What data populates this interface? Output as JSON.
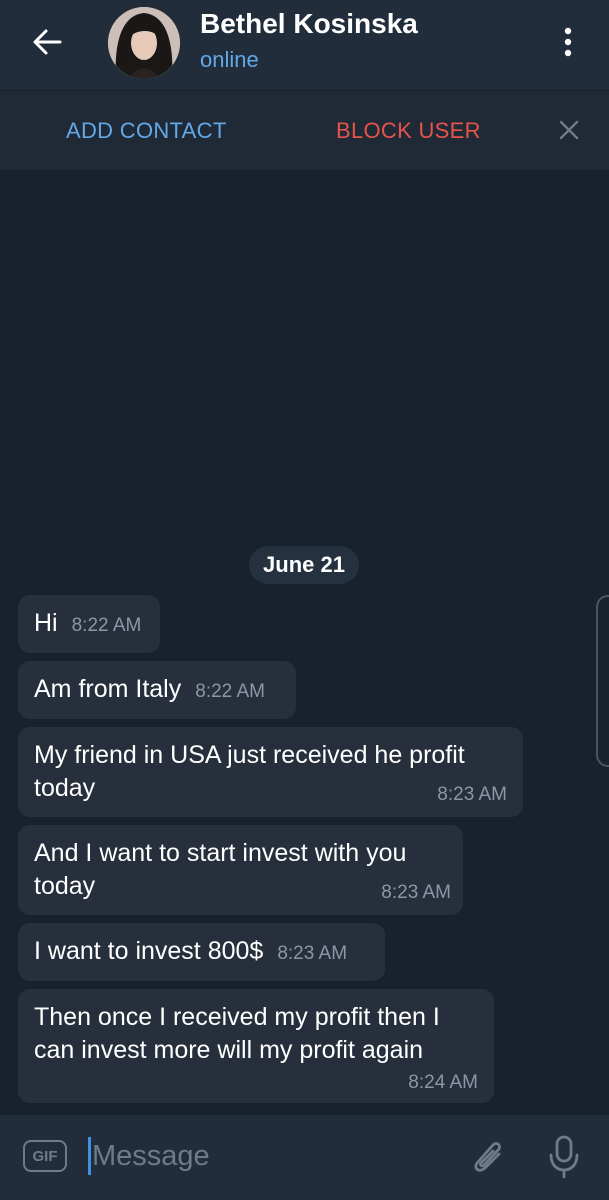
{
  "header": {
    "name": "Bethel Kosinska",
    "status": "online",
    "icons": {
      "back": "arrow-left-icon",
      "menu": "more-vertical-icon"
    }
  },
  "action_bar": {
    "add_contact": "ADD CONTACT",
    "block_user": "BLOCK USER",
    "close_icon": "close-icon"
  },
  "chat": {
    "date": "June 21",
    "messages": [
      {
        "text": "Hi",
        "time": "8:22 AM"
      },
      {
        "text": "Am from Italy",
        "time": "8:22 AM"
      },
      {
        "text": "My friend in USA just received he profit today",
        "time": "8:23 AM"
      },
      {
        "text": "And I want to start invest with you today",
        "time": "8:23 AM"
      },
      {
        "text": "I want to invest 800$",
        "time": "8:23 AM"
      },
      {
        "text": "Then once I received my profit then I can invest more will my profit again",
        "time": "8:24 AM"
      }
    ]
  },
  "composer": {
    "gif_label": "GIF",
    "placeholder": "Message",
    "icons": {
      "attach": "paperclip-icon",
      "mic": "microphone-icon"
    }
  },
  "colors": {
    "accent": "#62a8e8",
    "danger": "#e5544b",
    "chat_background": "#18222d",
    "bubble": "#262f3b",
    "header": "#212d3b"
  }
}
